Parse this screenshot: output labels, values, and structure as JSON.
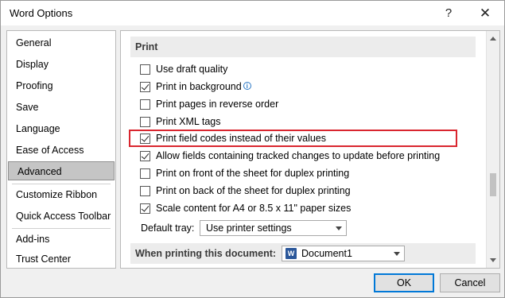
{
  "window": {
    "title": "Word Options",
    "help_glyph": "?",
    "close_glyph": "✕"
  },
  "nav": {
    "items": [
      {
        "label": "General"
      },
      {
        "label": "Display"
      },
      {
        "label": "Proofing"
      },
      {
        "label": "Save"
      },
      {
        "label": "Language"
      },
      {
        "label": "Ease of Access"
      },
      {
        "label": "Advanced",
        "selected": true
      },
      {
        "label": "Customize Ribbon"
      },
      {
        "label": "Quick Access Toolbar"
      },
      {
        "label": "Add-ins"
      },
      {
        "label": "Trust Center"
      }
    ]
  },
  "print_section": {
    "heading": "Print",
    "options": [
      {
        "label": "Use draft quality",
        "checked": false
      },
      {
        "label": "Print in background",
        "checked": true
      },
      {
        "label": "Print pages in reverse order",
        "checked": false
      },
      {
        "label": "Print XML tags",
        "checked": false
      },
      {
        "label": "Print field codes instead of their values",
        "checked": true
      },
      {
        "label": "Allow fields containing tracked changes to update before printing",
        "checked": true
      },
      {
        "label": "Print on front of the sheet for duplex printing",
        "checked": false
      },
      {
        "label": "Print on back of the sheet for duplex printing",
        "checked": false
      },
      {
        "label": "Scale content for A4 or 8.5 x 11\" paper sizes",
        "checked": true
      }
    ],
    "default_tray": {
      "label": "Default tray:",
      "value": "Use printer settings"
    }
  },
  "when_printing_section": {
    "heading": "When printing this document:",
    "document": "Document1",
    "document_icon_glyph": "W"
  },
  "buttons": {
    "ok": "OK",
    "cancel": "Cancel"
  },
  "icons": {
    "info": "info-icon",
    "help": "help-icon",
    "close": "close-icon",
    "word_doc": "word-document-icon"
  },
  "colors": {
    "highlight_border": "#d9262f",
    "selected_nav": "#c5c5c5",
    "primary_button_border": "#0078d7",
    "word_blue": "#2b579a"
  }
}
